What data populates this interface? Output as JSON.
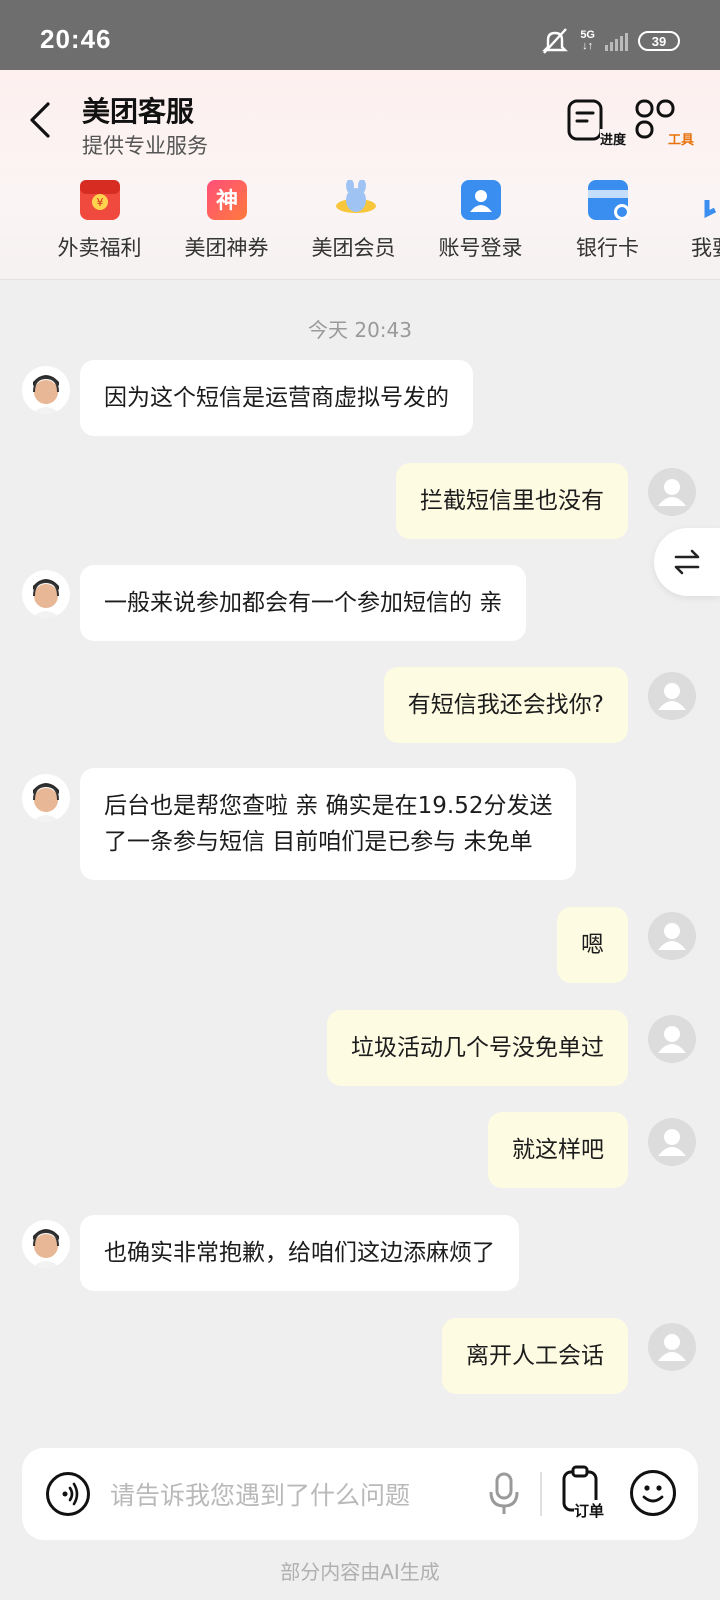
{
  "status_bar": {
    "time": "20:46",
    "network": "5G",
    "battery": "39"
  },
  "header": {
    "title": "美团客服",
    "subtitle": "提供专业服务",
    "progress_label": "进度",
    "tools_label": "工具",
    "quick_items": [
      {
        "label": "外卖福利",
        "icon": "red-packet-icon"
      },
      {
        "label": "美团神券",
        "icon": "shen-coupon-icon"
      },
      {
        "label": "美团会员",
        "icon": "kangaroo-member-icon"
      },
      {
        "label": "账号登录",
        "icon": "account-card-icon"
      },
      {
        "label": "银行卡",
        "icon": "bank-card-icon"
      },
      {
        "label": "我要",
        "icon": "partial-icon"
      }
    ]
  },
  "chat": {
    "timestamp": "今天 20:43",
    "messages": [
      {
        "from": "agent",
        "text": "因为这个短信是运营商虚拟号发的"
      },
      {
        "from": "user",
        "text": "拦截短信里也没有"
      },
      {
        "from": "agent",
        "text": "一般来说参加都会有一个参加短信的 亲"
      },
      {
        "from": "user",
        "text": "有短信我还会找你?"
      },
      {
        "from": "agent",
        "text_line1": "后台也是帮您查啦 亲 确实是在19.52分发送",
        "text_line2": "了一条参与短信 目前咱们是已参与 未免单"
      },
      {
        "from": "user",
        "text": "嗯"
      },
      {
        "from": "user",
        "text": "垃圾活动几个号没免单过"
      },
      {
        "from": "user",
        "text": "就这样吧"
      },
      {
        "from": "agent",
        "text": "也确实非常抱歉，给咱们这边添麻烦了"
      },
      {
        "from": "user",
        "text": "离开人工会话"
      }
    ]
  },
  "input": {
    "placeholder": "请告诉我您遇到了什么问题",
    "order_label": "订单"
  },
  "footer_note": "部分内容由AI生成",
  "colors": {
    "user_bubble": "#fefbe3",
    "agent_bubble": "#ffffff",
    "tool_accent": "#e8710a",
    "background": "#efefef"
  }
}
